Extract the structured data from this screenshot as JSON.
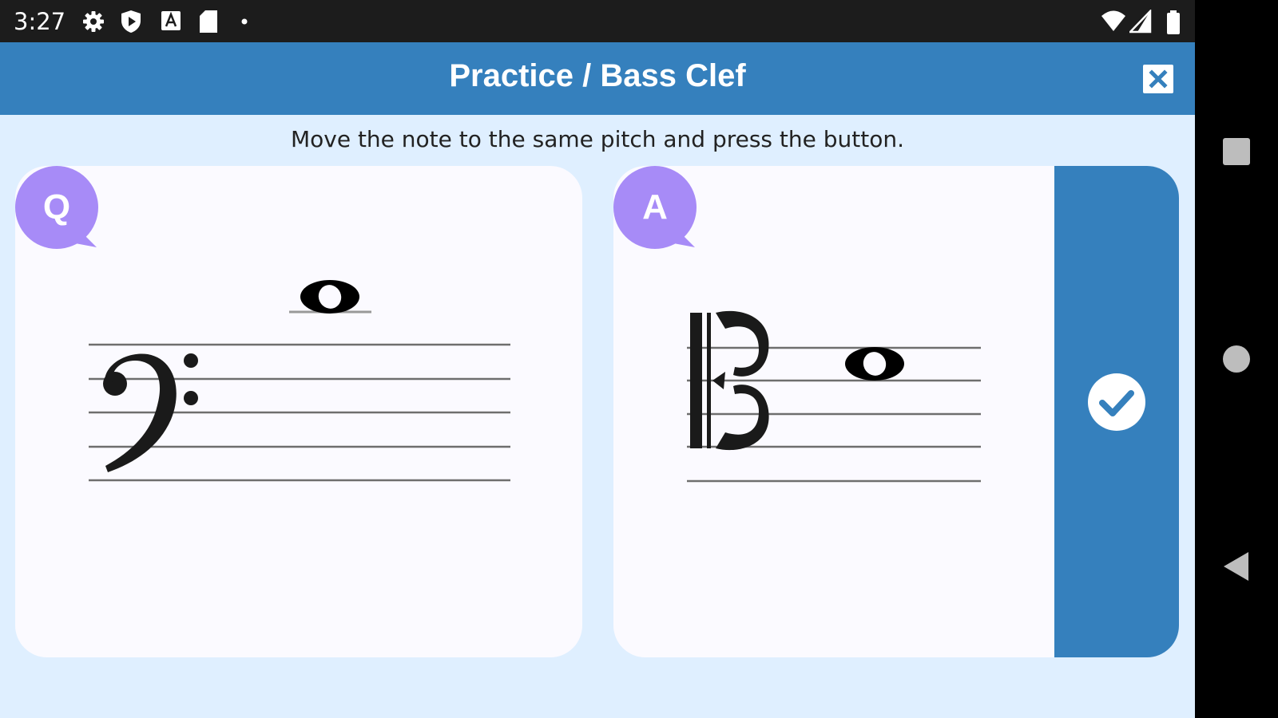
{
  "status": {
    "time": "3:27"
  },
  "app": {
    "title": "Practice / Bass Clef",
    "close_icon": "close-icon",
    "instruction": "Move the note to the same pitch and press the button."
  },
  "question_card": {
    "badge": "Q",
    "clef": "bass",
    "note": "whole note"
  },
  "answer_card": {
    "badge": "A",
    "clef": "alto (C clef)",
    "note": "whole note",
    "submit_icon": "checkmark-icon"
  },
  "colors": {
    "app_bar": "#3580bd",
    "background": "#dfefff",
    "card": "#fbfaff",
    "badge": "#a78bf7",
    "status_bar": "#1c1c1c"
  },
  "nav": {
    "items": [
      "recents",
      "home",
      "back"
    ]
  }
}
